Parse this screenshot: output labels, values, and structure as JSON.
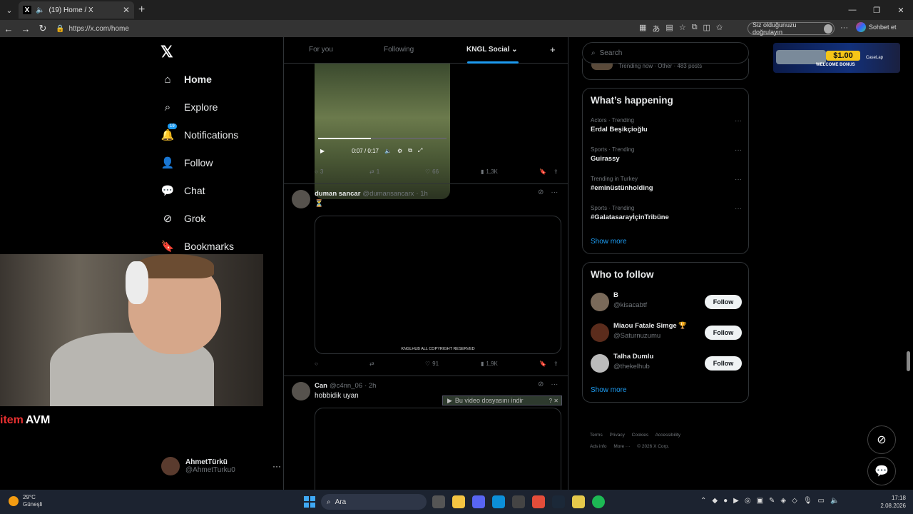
{
  "browser": {
    "tab_title": "(19) Home / X",
    "tab_icon": "x-logo-icon",
    "url": "https://x.com/home",
    "verify_label": "Siz olduğunuzu doğrulayın",
    "chat_label": "Sohbet et"
  },
  "sidebar": {
    "items": [
      {
        "label": "Home",
        "icon": "home-icon",
        "active": true
      },
      {
        "label": "Explore",
        "icon": "search-icon"
      },
      {
        "label": "Notifications",
        "icon": "bell-icon",
        "badge": "19"
      },
      {
        "label": "Follow",
        "icon": "add-person-icon"
      },
      {
        "label": "Chat",
        "icon": "chat-bubble-icon"
      },
      {
        "label": "Grok",
        "icon": "grok-icon"
      },
      {
        "label": "Bookmarks",
        "icon": "bookmark-icon"
      }
    ],
    "profile": {
      "name": "AhmetTürkü",
      "handle": "@AhmetTurku0"
    }
  },
  "overlay": {
    "brand_item": "item",
    "brand_avm": "AVM"
  },
  "feed": {
    "tabs": [
      {
        "label": "For you"
      },
      {
        "label": "Following"
      },
      {
        "label": "KNGL Social",
        "active": true
      }
    ],
    "video1": {
      "time": "0:07 / 0:17",
      "progress": 0.41,
      "replies": "3",
      "reposts": "1",
      "likes": "66",
      "views": "1,3K"
    },
    "post2": {
      "name": "duman sancar",
      "handle": "@dumansancarx",
      "time": "· 1h",
      "text": "⏳",
      "media_caption": "KNGLHUB ALL COPYRIGHT RESERVED",
      "replies": "",
      "reposts": "",
      "likes": "91",
      "views": "1,9K"
    },
    "post3": {
      "name": "Can",
      "handle": "@c4nn_06",
      "time": "· 2h",
      "text": "hobbidik uyan"
    },
    "download_bar": "Bu video dosyasını indir"
  },
  "right": {
    "search_placeholder": "Search",
    "prev_card_text": "Trending now · Other · 483 posts",
    "happening_title": "What’s happening",
    "trends": [
      {
        "meta": "Actors · Trending",
        "name": "Erdal Beşikçioğlu"
      },
      {
        "meta": "Sports · Trending",
        "name": "Guirassy"
      },
      {
        "meta": "Trending in Turkey",
        "name": "#eminüstünholding"
      },
      {
        "meta": "Sports · Trending",
        "name": "#GalatasarayİçinTribüne"
      }
    ],
    "show_more": "Show more",
    "wtf_title": "Who to follow",
    "who_to_follow": [
      {
        "name": "B",
        "handle": "@kisacabtf",
        "button": "Follow"
      },
      {
        "name": "Miaou Fatale Simge 🏆",
        "handle": "@Saturnuzumu",
        "button": "Follow"
      },
      {
        "name": "Talha Dumlu",
        "handle": "@thekelhub",
        "button": "Follow"
      }
    ],
    "footer": [
      "Terms",
      "Privacy",
      "Cookies",
      "Accessibility",
      "Ads info",
      "More ···",
      "© 2026 X Corp."
    ]
  },
  "ad": {
    "amount": "$1.00",
    "text": "WELCOME BONUS",
    "brand": "CaseLap"
  },
  "taskbar": {
    "temp": "29°C",
    "weather": "Güneşli",
    "search": "Ara",
    "time": "17:18",
    "date": "2.08.2026"
  }
}
